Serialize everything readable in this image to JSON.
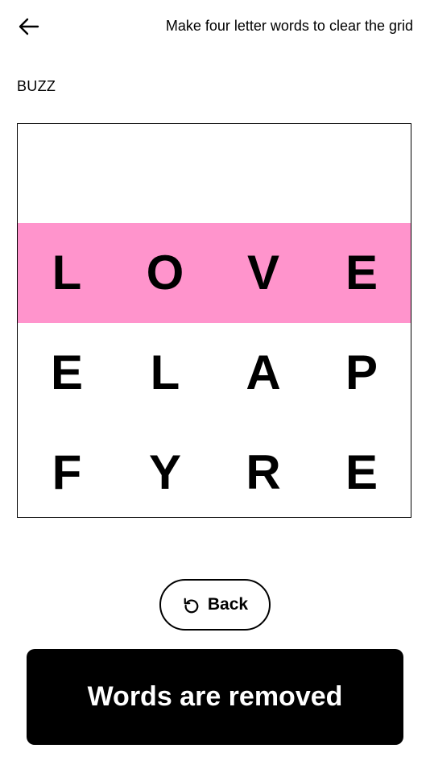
{
  "header": {
    "back_icon": "arrow-left-icon",
    "instruction": "Make four letter words to clear the grid"
  },
  "game": {
    "title": "BUZZ",
    "highlight_color": "#ff94cc",
    "grid": [
      [
        "",
        "",
        "",
        ""
      ],
      [
        "L",
        "O",
        "V",
        "E"
      ],
      [
        "E",
        "L",
        "A",
        "P"
      ],
      [
        "F",
        "Y",
        "R",
        "E"
      ]
    ],
    "highlighted_row": 2
  },
  "controls": {
    "back_label": "Back",
    "back_icon": "undo-icon",
    "primary_label": "Words are removed"
  }
}
